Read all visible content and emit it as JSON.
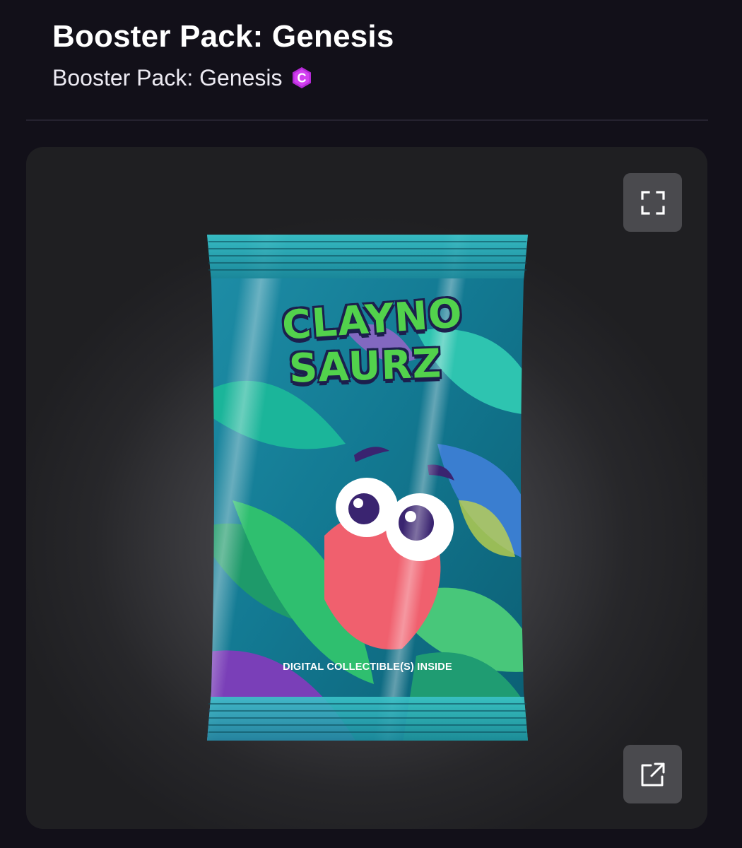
{
  "header": {
    "title": "Booster Pack: Genesis",
    "collection_name": "Booster Pack: Genesis",
    "collection_badge_icon": "magenta-c-badge-icon",
    "badge_letter": "C",
    "badge_color": "#b42ad6"
  },
  "viewer": {
    "image_alt": "Claynosaurz booster pack",
    "pack": {
      "logo_line_1": "CLAYNO",
      "logo_line_2": "SAURZ",
      "footer_text": "DIGITAL COLLECTIBLE(S) INSIDE"
    },
    "expand_icon": "fullscreen-expand-icon",
    "open_icon": "open-external-icon"
  },
  "colors": {
    "background": "#121019",
    "viewer_bg": "#2a2a2d",
    "button_bg": "#4a4a4e",
    "accent_magenta": "#b42ad6",
    "logo_green": "#52d24c"
  }
}
